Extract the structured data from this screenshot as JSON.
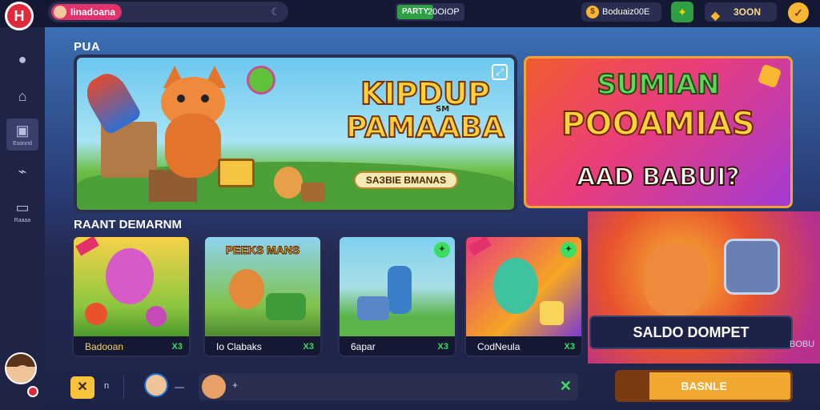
{
  "app": {
    "logo_text": "H",
    "colors": {
      "accent": "#e3316b",
      "gold": "#f7b733",
      "green": "#3ddc63",
      "bg": "#1a1f3d"
    }
  },
  "topbar": {
    "search_pill_label": "Iinadoana",
    "balance_tag": "PARTY",
    "balance_value": "20OIOP",
    "coins_icon": "coin-icon",
    "coins_value": "Boduaiz00E",
    "gift_icon": "gift-icon",
    "gems_value": "3OON",
    "user_icon": "user-icon"
  },
  "sidebar": {
    "items": [
      {
        "icon": "chat-icon",
        "label": ""
      },
      {
        "icon": "home-icon",
        "label": ""
      },
      {
        "icon": "chart-icon",
        "label": "Esonnd"
      },
      {
        "icon": "link-icon",
        "label": ""
      },
      {
        "icon": "gamepad-icon",
        "label": "Raaaa"
      }
    ]
  },
  "sections": {
    "featured_title": "PUA",
    "games_title": "RAANT DEMARNM"
  },
  "banner_main": {
    "title_line1": "KIPDUP",
    "title_sup": "SM",
    "title_line2": "PAMAABA",
    "cta_label": "SAЗBIE BMANAS",
    "badge_icon": "expand-icon"
  },
  "banner_side": {
    "line1": "SUMIAN",
    "line2": "POOAMIAS",
    "line3": "AAD BABUI?"
  },
  "games": [
    {
      "name": "Badooan",
      "count": "X3"
    },
    {
      "name": "Io Clabaks",
      "count": "X3",
      "title": "PEEKS MANS"
    },
    {
      "name": "6apar",
      "count": "X3"
    },
    {
      "name": "CodNeula",
      "count": "X3"
    }
  ],
  "wallet": {
    "label": "SALDO DOMPET",
    "side_text": "BOBU"
  },
  "bottombar": {
    "close_label": "✕",
    "n_label": "n",
    "dash_label": "—",
    "plus_label": "+",
    "send_icon": "check-icon",
    "cta_label": "BASNLE"
  }
}
